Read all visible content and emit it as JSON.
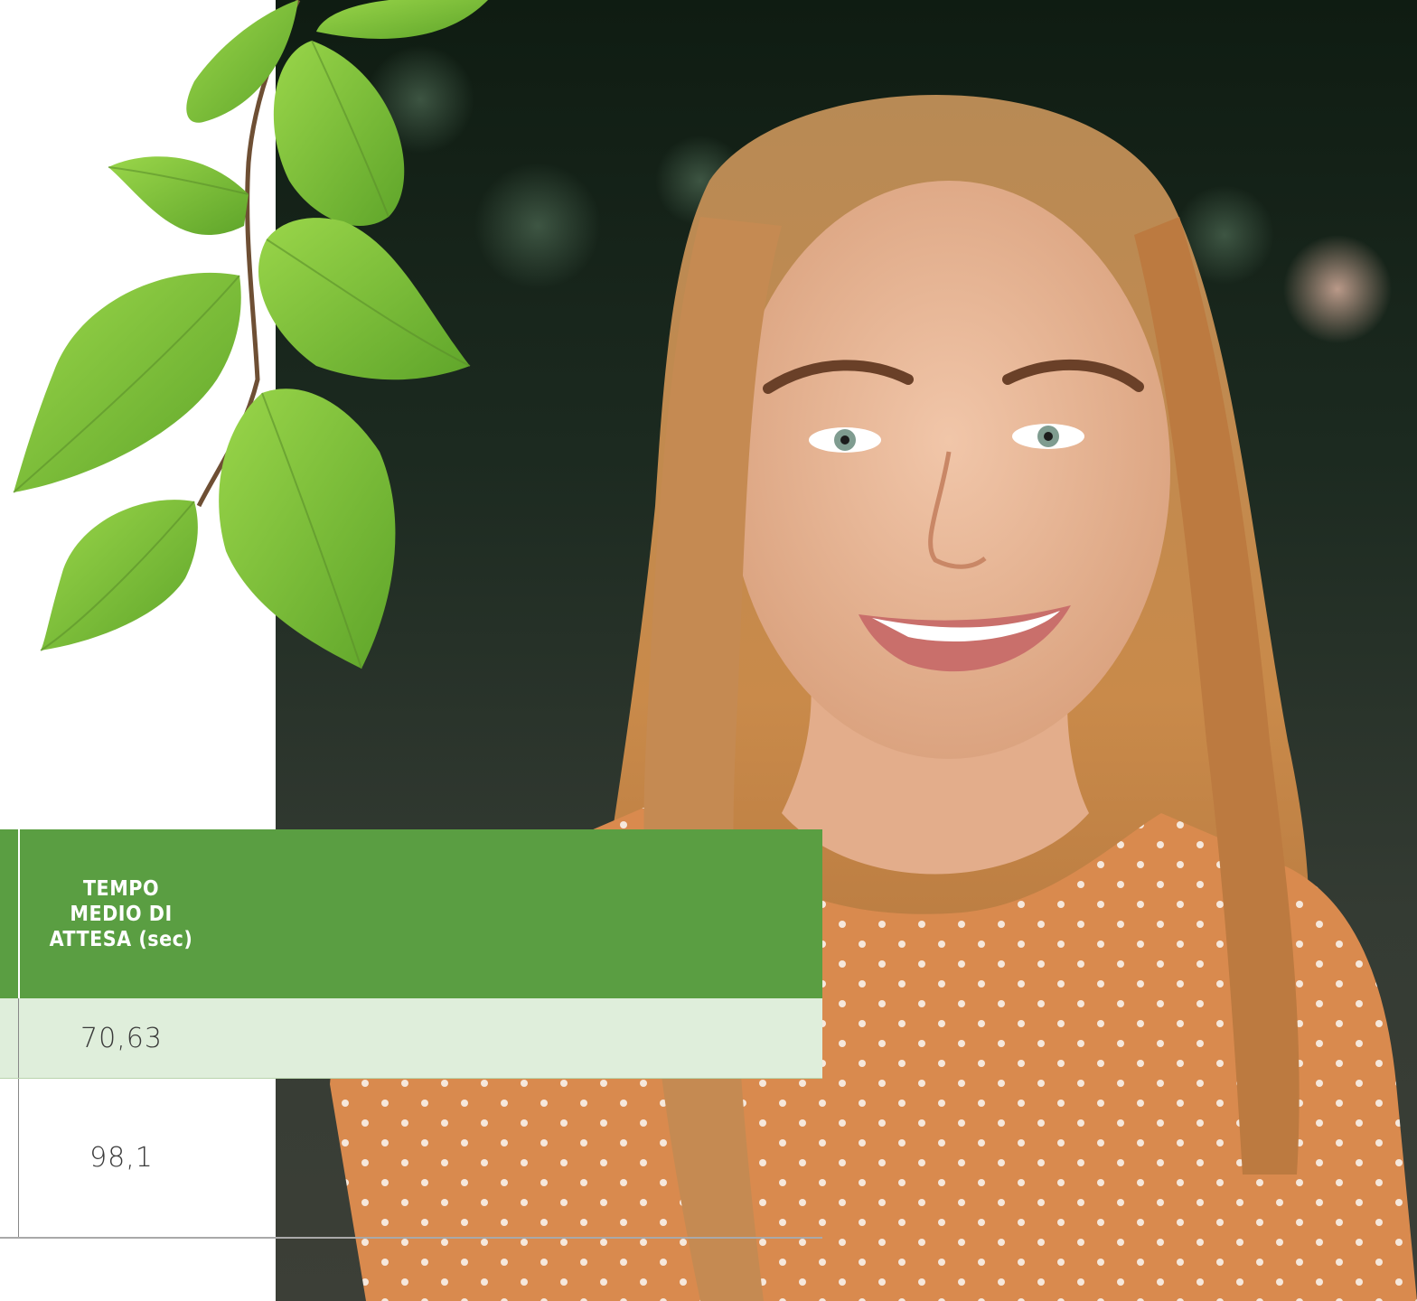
{
  "table": {
    "header": {
      "col_last": "TEMPO\nMEDIO DI\nATTESA (sec)"
    },
    "rows": [
      {
        "tempo_medio_attesa": "70,63"
      },
      {
        "tempo_medio_attesa": "98,1"
      }
    ]
  },
  "colors": {
    "header_green": "#5a9e42",
    "row_shade": "#dfeedb",
    "text_dark": "#3a3a3a",
    "leaf_green": "#7cc23a",
    "shirt_orange": "#d98a4e"
  },
  "images": {
    "photo": "smiling-woman-portrait",
    "decoration": "green-beech-leaves-branch"
  }
}
